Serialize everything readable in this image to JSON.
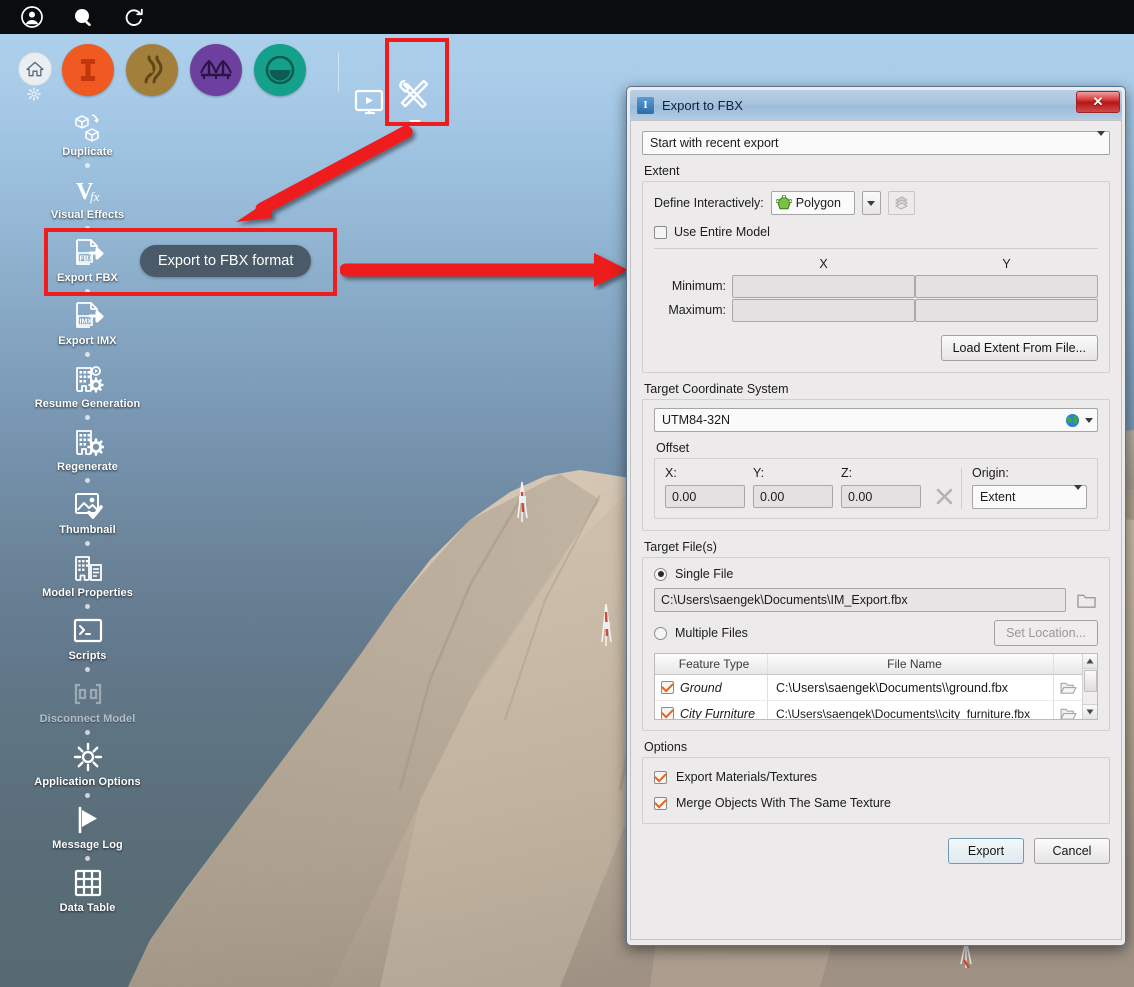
{
  "topbar": {
    "icons": [
      {
        "name": "account-icon",
        "glyph": "account"
      },
      {
        "name": "search-icon",
        "glyph": "search"
      },
      {
        "name": "refresh-icon",
        "glyph": "refresh"
      }
    ]
  },
  "ribbon": {
    "home_label": "home-icon",
    "settings_label": "gear-icon",
    "tools": [
      {
        "name": "infraworks-model-icon",
        "color": "#f05a22",
        "glyph": "I"
      },
      {
        "name": "roads-icon",
        "color": "#a2803c",
        "glyph": "road"
      },
      {
        "name": "bridge-icon",
        "color": "#6d3f9e",
        "glyph": "bridge"
      },
      {
        "name": "tunnel-icon",
        "color": "#14a08a",
        "glyph": "tunnel"
      }
    ],
    "present_label": "presentation-icon",
    "tools_label": "tools-icon"
  },
  "sidebar": {
    "items": [
      {
        "label": "Duplicate",
        "icon": "duplicate-icon",
        "disabled": false
      },
      {
        "label": "Visual Effects",
        "icon": "visual-effects-icon",
        "disabled": false
      },
      {
        "label": "Export FBX",
        "icon": "export-fbx-icon",
        "disabled": false
      },
      {
        "label": "Export IMX",
        "icon": "export-imx-icon",
        "disabled": false
      },
      {
        "label": "Resume Generation",
        "icon": "resume-generation-icon",
        "disabled": false
      },
      {
        "label": "Regenerate",
        "icon": "regenerate-icon",
        "disabled": false
      },
      {
        "label": "Thumbnail",
        "icon": "thumbnail-icon",
        "disabled": false
      },
      {
        "label": "Model Properties",
        "icon": "model-properties-icon",
        "disabled": false
      },
      {
        "label": "Scripts",
        "icon": "scripts-icon",
        "disabled": false
      },
      {
        "label": "Disconnect Model",
        "icon": "disconnect-model-icon",
        "disabled": true
      },
      {
        "label": "Application Options",
        "icon": "application-options-icon",
        "disabled": false
      },
      {
        "label": "Message Log",
        "icon": "message-log-icon",
        "disabled": false
      },
      {
        "label": "Data Table",
        "icon": "data-table-icon",
        "disabled": false
      }
    ],
    "tooltip": "Export to FBX format"
  },
  "annotations": {
    "highlight_color": "#ee1c1c",
    "arrow_color": "#ee1c1c"
  },
  "dialog": {
    "title": "Export to FBX",
    "app_icon_glyph": "I",
    "close_label": "✕",
    "preset": {
      "value": "Start with recent export"
    },
    "extent": {
      "group_label": "Extent",
      "define_label": "Define Interactively:",
      "define_value": "Polygon",
      "pick_button": "pick-extent-icon",
      "use_entire_model_label": "Use Entire Model",
      "use_entire_model_checked": false,
      "col_x": "X",
      "col_y": "Y",
      "row_min": "Minimum:",
      "row_max": "Maximum:",
      "min_x": "",
      "min_y": "",
      "max_x": "",
      "max_y": "",
      "load_extent_button": "Load Extent From File..."
    },
    "coord": {
      "group_label": "Target Coordinate System",
      "value": "UTM84-32N",
      "offset_label": "Offset",
      "x_label": "X:",
      "y_label": "Y:",
      "z_label": "Z:",
      "x_value": "0.00",
      "y_value": "0.00",
      "z_value": "0.00",
      "clear_button": "clear-offset-icon",
      "origin_label": "Origin:",
      "origin_value": "Extent"
    },
    "files": {
      "group_label": "Target File(s)",
      "single_file_label": "Single File",
      "single_file_selected": true,
      "single_file_path": "C:\\Users\\saengek\\Documents\\IM_Export.fbx",
      "browse_button": "folder-icon",
      "multiple_files_label": "Multiple Files",
      "multiple_files_selected": false,
      "set_location_button": "Set Location...",
      "table": {
        "headers": [
          "Feature Type",
          "File Name"
        ],
        "rows": [
          {
            "checked": true,
            "feature_type": "Ground",
            "file_name": "C:\\Users\\saengek\\Documents\\\\ground.fbx"
          },
          {
            "checked": true,
            "feature_type": "City Furniture",
            "file_name": "C:\\Users\\saengek\\Documents\\\\city_furniture.fbx"
          }
        ]
      }
    },
    "options": {
      "group_label": "Options",
      "items": [
        {
          "label": "Export Materials/Textures",
          "checked": true
        },
        {
          "label": "Merge Objects With The Same Texture",
          "checked": true
        }
      ]
    },
    "buttons": {
      "export": "Export",
      "cancel": "Cancel"
    }
  }
}
